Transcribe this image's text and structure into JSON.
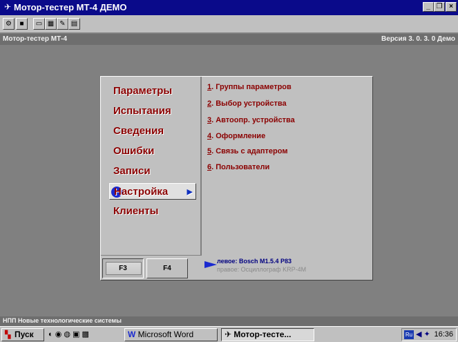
{
  "window": {
    "title": "Мотор-тестер МТ-4 ДЕМО",
    "minimize": "_",
    "restore": "❐",
    "close": "×"
  },
  "toolbar": {
    "icons": [
      "gear-icon",
      "stop-icon",
      "folder-icon",
      "chart-icon",
      "edit-icon",
      "window-icon"
    ]
  },
  "header": {
    "left": "Мотор-тестер МТ-4",
    "right": "Версия  3. 0. 3. 0 Демо"
  },
  "menu": {
    "items": [
      {
        "label": "Параметры"
      },
      {
        "label": "Испытания"
      },
      {
        "label": "Сведения"
      },
      {
        "label": "Ошибки"
      },
      {
        "label": "Записи"
      },
      {
        "label": "Настройка",
        "active": true
      },
      {
        "label": "Клиенты"
      }
    ]
  },
  "submenu": {
    "items": [
      {
        "num": "1",
        "text": ". Группы параметров"
      },
      {
        "num": "2",
        "text": ". Выбор устройства"
      },
      {
        "num": "3",
        "text": ". Автоопр. устройства"
      },
      {
        "num": "4",
        "text": ". Оформление"
      },
      {
        "num": "5",
        "text": ". Связь с адаптером"
      },
      {
        "num": "6",
        "text": ". Пользователи"
      }
    ]
  },
  "fkeys": {
    "f3": "F3",
    "f4": "F4"
  },
  "devices": {
    "left": "левое:  Bosch M1.5.4 P83",
    "right": "правое: Осциллограф KRP-4M"
  },
  "footer": {
    "company": "НПП Новые технологические системы"
  },
  "taskbar": {
    "start": "Пуск",
    "tasks": [
      {
        "label": "Microsoft Word"
      },
      {
        "label": "Мотор-тесте..."
      }
    ],
    "tray": {
      "lang": "Ru",
      "clock": "16:36"
    }
  },
  "colors": {
    "titlebar": "#0a0a8a",
    "menu_text": "#8b0000",
    "desktop": "#808080",
    "panel": "#c0c0c0"
  }
}
